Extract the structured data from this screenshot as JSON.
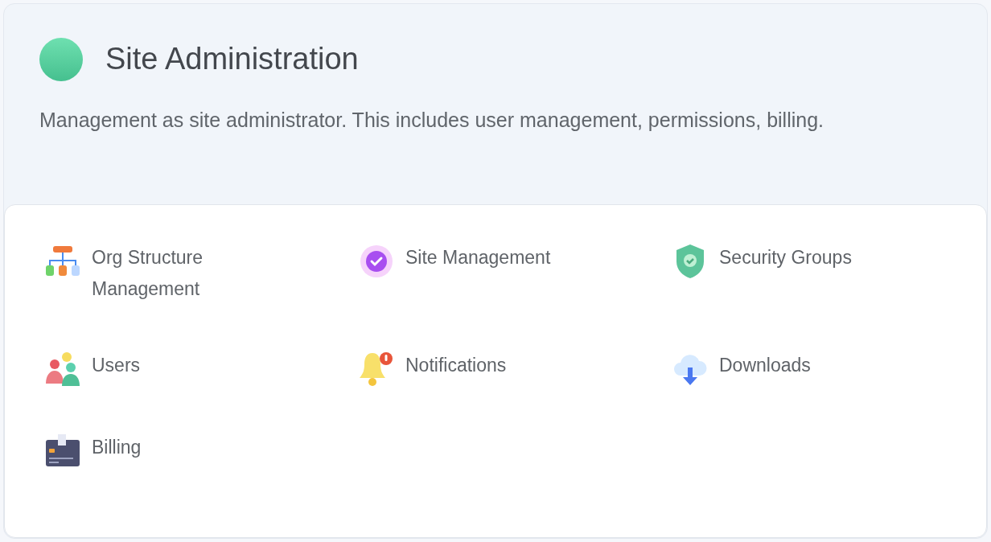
{
  "header": {
    "title": "Site Administration",
    "description": "Management as site administrator. This includes user management, permissions, billing."
  },
  "items": [
    {
      "kind": "org",
      "label": "Org Structure Management"
    },
    {
      "kind": "site",
      "label": "Site Management"
    },
    {
      "kind": "security",
      "label": "Security Groups"
    },
    {
      "kind": "users",
      "label": "Users"
    },
    {
      "kind": "bell",
      "label": "Notifications"
    },
    {
      "kind": "download",
      "label": "Downloads"
    },
    {
      "kind": "card",
      "label": "Billing"
    }
  ]
}
